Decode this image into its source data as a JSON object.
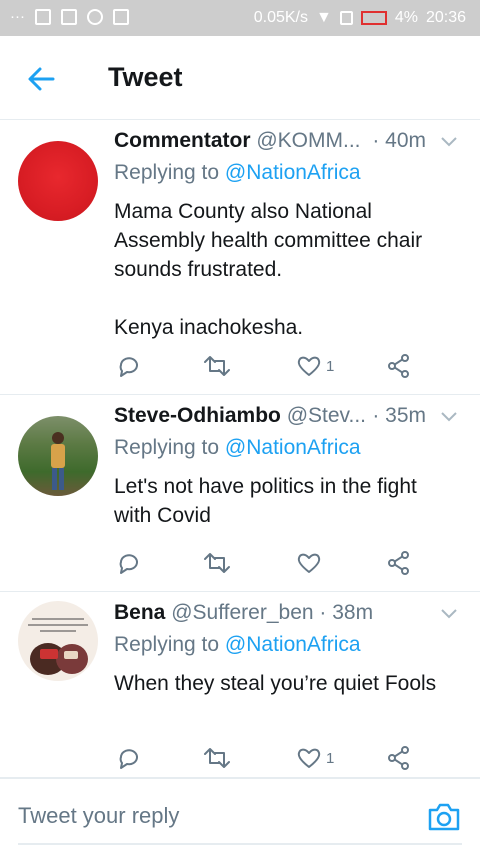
{
  "statusbar": {
    "net_speed": "0.05K/s",
    "battery": "4%",
    "time": "20:36"
  },
  "header": {
    "title": "Tweet"
  },
  "tweets": [
    {
      "name": "Commentator",
      "handle": "@KOMM...",
      "time": "· 40m",
      "replying_prefix": "Replying to",
      "replying_to": "@NationAfrica",
      "text": "Mama County also National Assembly health committee chair sounds frustrated.\n\nKenya inachokesha.",
      "likes": "1"
    },
    {
      "name": "Steve-Odhiambo",
      "handle": "@Stev...",
      "time": "· 35m",
      "replying_prefix": "Replying to",
      "replying_to": "@NationAfrica",
      "text": "Let's not have politics in the fight with Covid",
      "likes": ""
    },
    {
      "name": "Bena",
      "handle": "@Sufferer_ben",
      "time": "· 38m",
      "replying_prefix": "Replying to",
      "replying_to": "@NationAfrica",
      "text": "When they steal you’re quiet Fools",
      "likes": "1"
    }
  ],
  "composer": {
    "placeholder": "Tweet your reply"
  },
  "colors": {
    "accent": "#1da1f2",
    "secondary": "#657786",
    "text": "#14171a"
  }
}
